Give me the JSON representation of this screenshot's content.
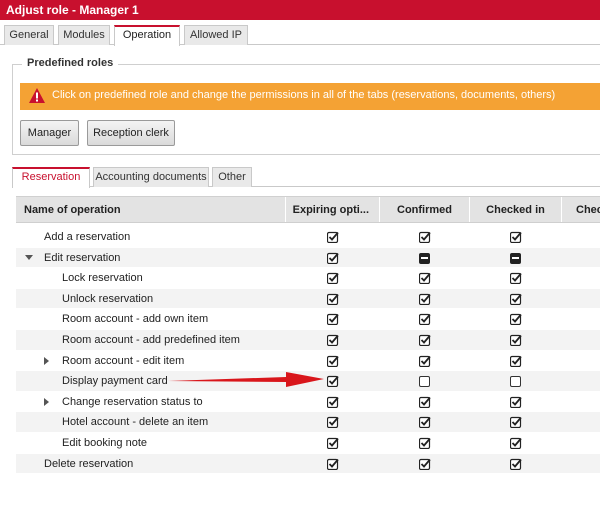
{
  "window": {
    "title": "Adjust role - Manager 1"
  },
  "top_tabs": [
    {
      "label": "General"
    },
    {
      "label": "Modules"
    },
    {
      "label": "Operation",
      "active": true
    },
    {
      "label": "Allowed IP"
    }
  ],
  "predefined": {
    "legend": "Predefined roles",
    "warning": "Click on predefined role and change the permissions in all of the tabs (reservations, documents, others)",
    "buttons": [
      {
        "label": "Manager"
      },
      {
        "label": "Reception clerk"
      }
    ]
  },
  "sub_tabs": [
    {
      "label": "Reservation",
      "active": true
    },
    {
      "label": "Accounting documents"
    },
    {
      "label": "Other"
    }
  ],
  "grid": {
    "columns": [
      {
        "label": "Name of operation"
      },
      {
        "label": "Expiring opti..."
      },
      {
        "label": "Confirmed"
      },
      {
        "label": "Checked in"
      },
      {
        "label": "Chec"
      }
    ],
    "rows": [
      {
        "label": "Add a reservation",
        "level": 0,
        "expander": "",
        "states": [
          "on",
          "on",
          "on"
        ]
      },
      {
        "label": "Edit reservation",
        "level": 0,
        "expander": "down",
        "states": [
          "on",
          "partial",
          "partial"
        ]
      },
      {
        "label": "Lock reservation",
        "level": 1,
        "expander": "",
        "states": [
          "on",
          "on",
          "on"
        ]
      },
      {
        "label": "Unlock reservation",
        "level": 1,
        "expander": "",
        "states": [
          "on",
          "on",
          "on"
        ]
      },
      {
        "label": "Room account - add own item",
        "level": 1,
        "expander": "",
        "states": [
          "on",
          "on",
          "on"
        ]
      },
      {
        "label": "Room account - add predefined item",
        "level": 1,
        "expander": "",
        "states": [
          "on",
          "on",
          "on"
        ]
      },
      {
        "label": "Room account - edit item",
        "level": 1,
        "expander": "right",
        "states": [
          "on",
          "on",
          "on"
        ]
      },
      {
        "label": "Display payment card",
        "level": 1,
        "expander": "",
        "states": [
          "on",
          "off",
          "off"
        ]
      },
      {
        "label": "Change reservation status to",
        "level": 1,
        "expander": "right",
        "states": [
          "on",
          "on",
          "on"
        ]
      },
      {
        "label": "Hotel account - delete an item",
        "level": 1,
        "expander": "",
        "states": [
          "on",
          "on",
          "on"
        ]
      },
      {
        "label": "Edit booking note",
        "level": 1,
        "expander": "",
        "states": [
          "on",
          "on",
          "on"
        ]
      },
      {
        "label": "Delete reservation",
        "level": 0,
        "expander": "",
        "states": [
          "on",
          "on",
          "on"
        ]
      }
    ]
  },
  "colors": {
    "title_bar": "#c8102e",
    "warning_bg": "#f4a234",
    "annotation_arrow": "#d9161b"
  }
}
